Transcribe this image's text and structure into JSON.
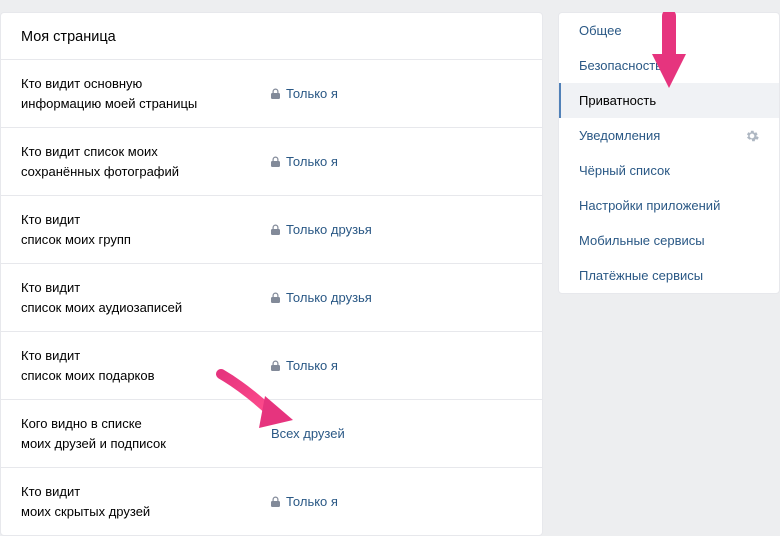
{
  "panel_title": "Моя страница",
  "settings": [
    {
      "label_line1": "Кто видит основную",
      "label_line2_pre": "информацию ",
      "label_line2_bold": "моей страницы",
      "value": "Только я",
      "has_lock": true
    },
    {
      "label_line1": "Кто видит список моих",
      "label_line2_pre": "",
      "label_line2_bold": "сохранённых фотографий",
      "value": "Только я",
      "has_lock": true
    },
    {
      "label_line1": "Кто видит",
      "label_line2_pre": "список моих ",
      "label_line2_bold": "групп",
      "value": "Только друзья",
      "has_lock": true
    },
    {
      "label_line1": "Кто видит",
      "label_line2_pre": "список моих ",
      "label_line2_bold": "аудиозаписей",
      "value": "Только друзья",
      "has_lock": true
    },
    {
      "label_line1": "Кто видит",
      "label_line2_pre": "список моих ",
      "label_line2_bold": "подарков",
      "value": "Только я",
      "has_lock": true
    },
    {
      "label_line1": "Кого видно в списке",
      "label_line2_pre": "моих ",
      "label_line2_bold": "друзей и подписок",
      "value": "Всех друзей",
      "has_lock": false
    },
    {
      "label_line1": "Кто видит",
      "label_line2_pre": "моих ",
      "label_line2_bold": "скрытых друзей",
      "value": "Только я",
      "has_lock": true
    }
  ],
  "sidebar": {
    "items": [
      {
        "label": "Общее",
        "active": false,
        "has_gear": false
      },
      {
        "label": "Безопасность",
        "active": false,
        "has_gear": false
      },
      {
        "label": "Приватность",
        "active": true,
        "has_gear": false
      },
      {
        "label": "Уведомления",
        "active": false,
        "has_gear": true
      },
      {
        "label": "Чёрный список",
        "active": false,
        "has_gear": false
      },
      {
        "label": "Настройки приложений",
        "active": false,
        "has_gear": false
      },
      {
        "label": "Мобильные сервисы",
        "active": false,
        "has_gear": false
      },
      {
        "label": "Платёжные сервисы",
        "active": false,
        "has_gear": false
      }
    ]
  },
  "colors": {
    "link": "#2a5885",
    "arrow": "#e6347e"
  }
}
